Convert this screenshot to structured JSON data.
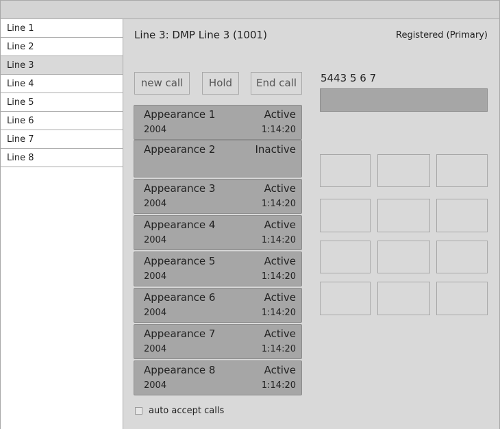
{
  "sidebar": {
    "items": [
      {
        "label": "Line 1",
        "selected": false
      },
      {
        "label": "Line 2",
        "selected": false
      },
      {
        "label": "Line 3",
        "selected": true
      },
      {
        "label": "Line 4",
        "selected": false
      },
      {
        "label": "Line 5",
        "selected": false
      },
      {
        "label": "Line 6",
        "selected": false
      },
      {
        "label": "Line 7",
        "selected": false
      },
      {
        "label": "Line 8",
        "selected": false
      }
    ]
  },
  "main": {
    "title": "Line 3: DMP Line 3 (1001)",
    "registration_status": "Registered (Primary)",
    "buttons": {
      "new_call": "new call",
      "hold": "Hold",
      "end_call": "End call"
    },
    "appearances": [
      {
        "name": "Appearance 1",
        "status": "Active",
        "number": "2004",
        "time": "1:14:20"
      },
      {
        "name": "Appearance 2",
        "status": "Inactive",
        "number": "",
        "time": ""
      },
      {
        "name": "Appearance 3",
        "status": "Active",
        "number": "2004",
        "time": "1:14:20"
      },
      {
        "name": "Appearance 4",
        "status": "Active",
        "number": "2004",
        "time": "1:14:20"
      },
      {
        "name": "Appearance 5",
        "status": "Active",
        "number": "2004",
        "time": "1:14:20"
      },
      {
        "name": "Appearance 6",
        "status": "Active",
        "number": "2004",
        "time": "1:14:20"
      },
      {
        "name": "Appearance 7",
        "status": "Active",
        "number": "2004",
        "time": "1:14:20"
      },
      {
        "name": "Appearance 8",
        "status": "Active",
        "number": "2004",
        "time": "1:14:20"
      }
    ],
    "auto_accept_label": "auto accept calls",
    "auto_accept_checked": false
  },
  "dialer": {
    "number": "5443 5 6 7"
  }
}
